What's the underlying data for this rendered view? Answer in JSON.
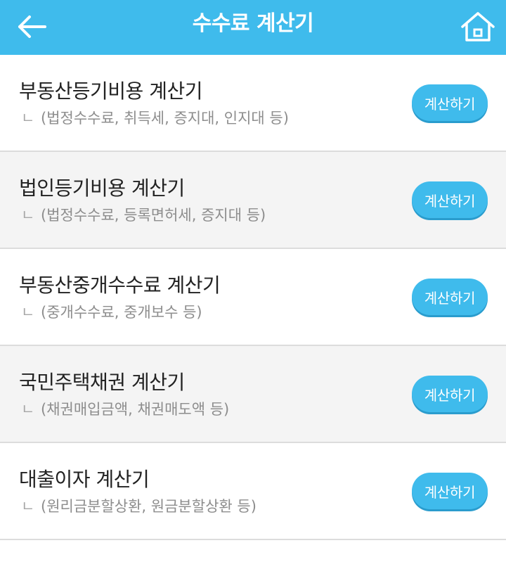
{
  "header": {
    "title": "수수료 계산기",
    "back_icon": "arrow-left-icon",
    "home_icon": "home-icon",
    "color": "#3fbbec"
  },
  "items": [
    {
      "title": "부동산등기비용 계산기",
      "sub_mark": "ㄴ",
      "subtitle": "(법정수수료, 취득세, 증지대, 인지대 등)",
      "button": "계산하기"
    },
    {
      "title": "법인등기비용 계산기",
      "sub_mark": "ㄴ",
      "subtitle": "(법정수수료, 등록면허세, 증지대 등)",
      "button": "계산하기"
    },
    {
      "title": "부동산중개수수료 계산기",
      "sub_mark": "ㄴ",
      "subtitle": "(중개수수료, 중개보수 등)",
      "button": "계산하기"
    },
    {
      "title": "국민주택채권 계산기",
      "sub_mark": "ㄴ",
      "subtitle": "(채권매입금액, 채권매도액 등)",
      "button": "계산하기"
    },
    {
      "title": "대출이자 계산기",
      "sub_mark": "ㄴ",
      "subtitle": "(원리금분할상환, 원금분할상환 등)",
      "button": "계산하기"
    }
  ]
}
